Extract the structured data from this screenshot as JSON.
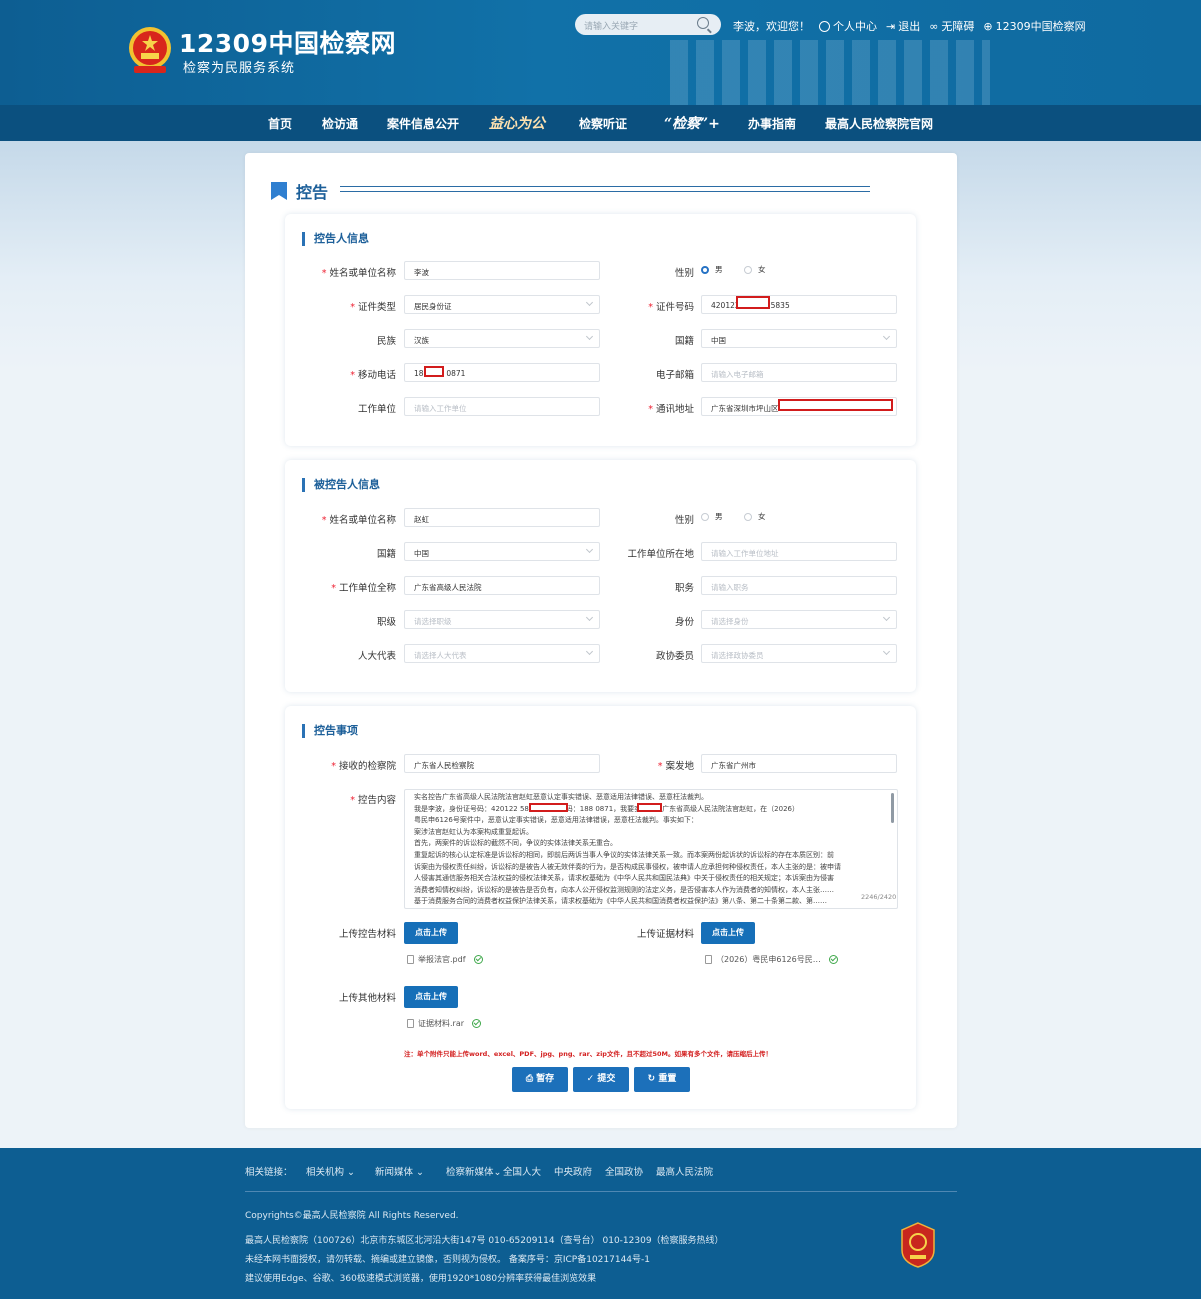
{
  "header": {
    "site_title": "12309中国检察网",
    "site_subtitle": "检察为民服务系统",
    "search_placeholder": "请输入关键字",
    "welcome": "李波，欢迎您！",
    "user_center": "个人中心",
    "logout": "退出",
    "accessibility": "无障碍",
    "home_site": "12309中国检察网"
  },
  "nav": [
    "首页",
    "检访通",
    "案件信息公开",
    "益心为公",
    "检察听证",
    "“检察”+",
    "办事指南",
    "最高人民检察院官网"
  ],
  "page_title": "控告",
  "sections": {
    "complainant": {
      "title": "控告人信息",
      "name_label": "姓名或单位名称",
      "name_value": "李波",
      "gender_label": "性别",
      "gender_male": "男",
      "gender_female": "女",
      "gender_selected": "男",
      "idtype_label": "证件类型",
      "idtype_value": "居民身份证",
      "idno_label": "证件号码",
      "idno_prefix": "420122",
      "idno_suffix": "5835",
      "ethnic_label": "民族",
      "ethnic_value": "汉族",
      "nation_label": "国籍",
      "nation_value": "中国",
      "mobile_label": "移动电话",
      "mobile_prefix": "188",
      "mobile_suffix": "0871",
      "email_label": "电子邮箱",
      "email_placeholder": "请输入电子邮箱",
      "work_label": "工作单位",
      "work_placeholder": "请输入工作单位",
      "address_label": "通讯地址",
      "address_value": "广东省深圳市坪山区"
    },
    "respondent": {
      "title": "被控告人信息",
      "name_label": "姓名或单位名称",
      "name_value": "赵虹",
      "gender_label": "性别",
      "gender_male": "男",
      "gender_female": "女",
      "nation_label": "国籍",
      "nation_value": "中国",
      "workloc_label": "工作单位所在地",
      "workloc_placeholder": "请输入工作单位地址",
      "workfull_label": "工作单位全称",
      "workfull_value": "广东省高级人民法院",
      "post_label": "职务",
      "post_placeholder": "请输入职务",
      "rank_label": "职级",
      "rank_placeholder": "请选择职级",
      "identity_label": "身份",
      "identity_placeholder": "请选择身份",
      "npc_label": "人大代表",
      "npc_placeholder": "请选择人大代表",
      "cppcc_label": "政协委员",
      "cppcc_placeholder": "请选择政协委员"
    },
    "matter": {
      "title": "控告事项",
      "procuratorate_label": "接收的检察院",
      "procuratorate_value": "广东省人民检察院",
      "place_label": "案发地",
      "place_value": "广东省广州市",
      "content_label": "控告内容",
      "content_lines": [
        "实名控告广东省高级人民法院法官赵虹恶意认定事实错误、恶意适用法律错误、恶意枉法裁判。",
        "    我是李波，身份证号码：420122            5835，电话号码：188          0871，我要实名举报广东省高级人民法院法官赵虹，在（2026）",
        "粤民申6126号案件中，恶意认定事实错误，恶意适用法律错误，恶意枉法裁判。事实如下：",
        "案涉法官赵虹认为本案构成重复起诉。",
        "首先，两案件的诉讼标的截然不同，争议的实体法律关系无重合。",
        "重复起诉的核心认定标准是诉讼标的相同，即前后两诉当事人争议的实体法律关系一致。而本案两份起诉状的诉讼标的存在本质区别：前",
        "诉案由为侵权责任纠纷，诉讼标的是被告人被无效伴奏的行为，是否构成民事侵权，被申请人应承担何种侵权责任，本人主张的是：被申请",
        "人侵害其通信服务相关合法权益的侵权法律关系，请求权基础为《中华人民共和国民法典》中关于侵权责任的相关规定；本诉案由为侵害",
        "消费者知情权纠纷，诉讼标的是被告是否负有，向本人公开侵权监测规则的法定义务，是否侵害本人作为消费者的知情权，本人主张……",
        "基于消费服务合同的消费者权益保护法律关系，请求权基础为《中华人民共和国消费者权益保护法》第八条、第二十条第二款、第……"
      ],
      "char_count": "2246/2420",
      "upload_complaint_label": "上传控告材料",
      "upload_evidence_label": "上传证据材料",
      "upload_other_label": "上传其他材料",
      "upload_button": "点击上传",
      "file_complaint": "举报法官.pdf",
      "file_evidence": "（2026）粤民申6126号民…",
      "file_other": "证据材料.rar",
      "note": "注：单个附件只能上传word、excel、PDF、jpg、png、rar、zip文件，且不超过50M。如果有多个文件，请压缩后上传！",
      "save_button": "暂存",
      "submit_button": "提交",
      "reset_button": "重置"
    }
  },
  "footer": {
    "links_label": "相关链接：",
    "links": [
      "相关机构",
      "新闻媒体",
      "检察新媒体",
      "全国人大",
      "中央政府",
      "全国政协",
      "最高人民法院"
    ],
    "copyright": "Copyrights©最高人民检察院 All Rights Reserved.",
    "address": "最高人民检察院（100726）北京市东城区北河沿大街147号 010-65209114（查号台） 010-12309（检察服务热线）",
    "notice": "未经本网书面授权，请勿转载、摘编或建立镜像，否则视为侵权。 备案序号：京ICP备10217144号-1",
    "browser": "建议使用Edge、谷歌、360极速模式浏览器，使用1920*1080分辨率获得最佳浏览效果"
  },
  "colors": {
    "brand_blue": "#0d5e92",
    "nav_blue": "#0b507f",
    "button_blue": "#1c70ba",
    "required_red": "#e23",
    "redact_red": "#d21c1c"
  }
}
